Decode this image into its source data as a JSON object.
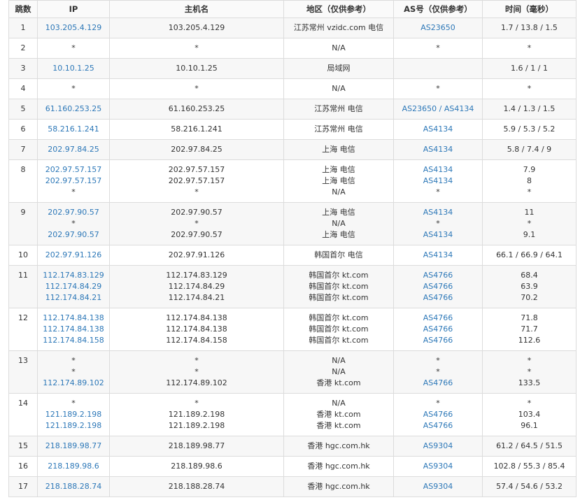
{
  "headers": [
    "跳数",
    "IP",
    "主机名",
    "地区（仅供参考）",
    "AS号（仅供参考）",
    "时间（毫秒）"
  ],
  "hops": [
    {
      "hop": "1",
      "lines": [
        {
          "ip": "103.205.4.129",
          "host": "103.205.4.129",
          "region": "江苏常州 vzidc.com 电信",
          "as": "AS23650",
          "time": "1.7 / 13.8 / 1.5"
        }
      ]
    },
    {
      "hop": "2",
      "lines": [
        {
          "ip": "*",
          "host": "*",
          "region": "N/A",
          "as": "*",
          "time": "*"
        }
      ]
    },
    {
      "hop": "3",
      "lines": [
        {
          "ip": "10.10.1.25",
          "host": "10.10.1.25",
          "region": "局域网",
          "as": "",
          "time": "1.6 / 1 / 1"
        }
      ]
    },
    {
      "hop": "4",
      "lines": [
        {
          "ip": "*",
          "host": "*",
          "region": "N/A",
          "as": "*",
          "time": "*"
        }
      ]
    },
    {
      "hop": "5",
      "lines": [
        {
          "ip": "61.160.253.25",
          "host": "61.160.253.25",
          "region": "江苏常州 电信",
          "as": "AS23650 / AS4134",
          "time": "1.4 / 1.3 / 1.5"
        }
      ]
    },
    {
      "hop": "6",
      "lines": [
        {
          "ip": "58.216.1.241",
          "host": "58.216.1.241",
          "region": "江苏常州 电信",
          "as": "AS4134",
          "time": "5.9 / 5.3 / 5.2"
        }
      ]
    },
    {
      "hop": "7",
      "lines": [
        {
          "ip": "202.97.84.25",
          "host": "202.97.84.25",
          "region": "上海 电信",
          "as": "AS4134",
          "time": "5.8 / 7.4 / 9"
        }
      ]
    },
    {
      "hop": "8",
      "lines": [
        {
          "ip": "202.97.57.157",
          "host": "202.97.57.157",
          "region": "上海 电信",
          "as": "AS4134",
          "time": "7.9"
        },
        {
          "ip": "202.97.57.157",
          "host": "202.97.57.157",
          "region": "上海 电信",
          "as": "AS4134",
          "time": "8"
        },
        {
          "ip": "*",
          "host": "*",
          "region": "N/A",
          "as": "*",
          "time": "*"
        }
      ]
    },
    {
      "hop": "9",
      "lines": [
        {
          "ip": "202.97.90.57",
          "host": "202.97.90.57",
          "region": "上海 电信",
          "as": "AS4134",
          "time": "11"
        },
        {
          "ip": "*",
          "host": "*",
          "region": "N/A",
          "as": "*",
          "time": "*"
        },
        {
          "ip": "202.97.90.57",
          "host": "202.97.90.57",
          "region": "上海 电信",
          "as": "AS4134",
          "time": "9.1"
        }
      ]
    },
    {
      "hop": "10",
      "lines": [
        {
          "ip": "202.97.91.126",
          "host": "202.97.91.126",
          "region": "韩国首尔 电信",
          "as": "AS4134",
          "time": "66.1 / 66.9 / 64.1"
        }
      ]
    },
    {
      "hop": "11",
      "lines": [
        {
          "ip": "112.174.83.129",
          "host": "112.174.83.129",
          "region": "韩国首尔 kt.com",
          "as": "AS4766",
          "time": "68.4"
        },
        {
          "ip": "112.174.84.29",
          "host": "112.174.84.29",
          "region": "韩国首尔 kt.com",
          "as": "AS4766",
          "time": "63.9"
        },
        {
          "ip": "112.174.84.21",
          "host": "112.174.84.21",
          "region": "韩国首尔 kt.com",
          "as": "AS4766",
          "time": "70.2"
        }
      ]
    },
    {
      "hop": "12",
      "lines": [
        {
          "ip": "112.174.84.138",
          "host": "112.174.84.138",
          "region": "韩国首尔 kt.com",
          "as": "AS4766",
          "time": "71.8"
        },
        {
          "ip": "112.174.84.138",
          "host": "112.174.84.138",
          "region": "韩国首尔 kt.com",
          "as": "AS4766",
          "time": "71.7"
        },
        {
          "ip": "112.174.84.158",
          "host": "112.174.84.158",
          "region": "韩国首尔 kt.com",
          "as": "AS4766",
          "time": "112.6"
        }
      ]
    },
    {
      "hop": "13",
      "lines": [
        {
          "ip": "*",
          "host": "*",
          "region": "N/A",
          "as": "*",
          "time": "*"
        },
        {
          "ip": "*",
          "host": "*",
          "region": "N/A",
          "as": "*",
          "time": "*"
        },
        {
          "ip": "112.174.89.102",
          "host": "112.174.89.102",
          "region": "香港 kt.com",
          "as": "AS4766",
          "time": "133.5"
        }
      ]
    },
    {
      "hop": "14",
      "lines": [
        {
          "ip": "*",
          "host": "*",
          "region": "N/A",
          "as": "*",
          "time": "*"
        },
        {
          "ip": "121.189.2.198",
          "host": "121.189.2.198",
          "region": "香港 kt.com",
          "as": "AS4766",
          "time": "103.4"
        },
        {
          "ip": "121.189.2.198",
          "host": "121.189.2.198",
          "region": "香港 kt.com",
          "as": "AS4766",
          "time": "96.1"
        }
      ]
    },
    {
      "hop": "15",
      "lines": [
        {
          "ip": "218.189.98.77",
          "host": "218.189.98.77",
          "region": "香港 hgc.com.hk",
          "as": "AS9304",
          "time": "61.2 / 64.5 / 51.5"
        }
      ]
    },
    {
      "hop": "16",
      "lines": [
        {
          "ip": "218.189.98.6",
          "host": "218.189.98.6",
          "region": "香港 hgc.com.hk",
          "as": "AS9304",
          "time": "102.8 / 55.3 / 85.4"
        }
      ]
    },
    {
      "hop": "17",
      "lines": [
        {
          "ip": "218.188.28.74",
          "host": "218.188.28.74",
          "region": "香港 hgc.com.hk",
          "as": "AS9304",
          "time": "57.4 / 54.6 / 53.2"
        }
      ]
    }
  ]
}
